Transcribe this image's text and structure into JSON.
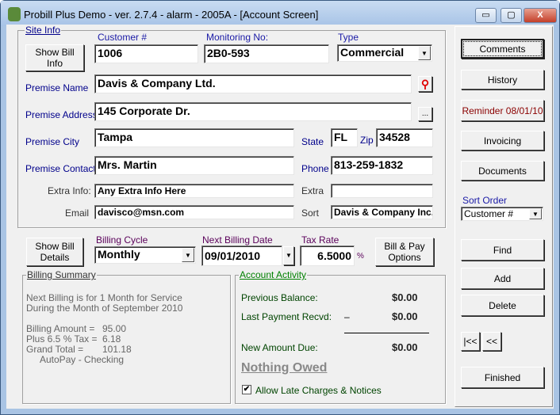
{
  "window": {
    "title": "Probill Plus Demo - ver. 2.7.4 - alarm - 2005A - [Account Screen]",
    "minimize": "▭",
    "maximize": "▢",
    "close": "X"
  },
  "site_info": {
    "group_label": "Site Info",
    "show_bill_info": "Show Bill Info",
    "customer_label": "Customer #",
    "customer": "1006",
    "monitoring_label": "Monitoring No:",
    "monitoring": "2B0-593",
    "type_label": "Type",
    "type": "Commercial",
    "premise_name_label": "Premise Name",
    "premise_name": "Davis & Company Ltd.",
    "premise_address_label": "Premise Address",
    "premise_address": "145 Corporate Dr.",
    "ellipsis": "...",
    "premise_city_label": "Premise City",
    "premise_city": "Tampa",
    "state_label": "State",
    "state": "FL",
    "zip_label": "Zip",
    "zip": "34528",
    "premise_contact_label": "Premise Contact",
    "premise_contact": "Mrs. Martin",
    "phone_label": "Phone",
    "phone": "813-259-1832",
    "extra_info_label": "Extra Info:",
    "extra_info": "Any Extra Info Here",
    "extra_label": "Extra",
    "extra": "",
    "email_label": "Email",
    "email": "davisco@msn.com",
    "sort_label": "Sort",
    "sort": "Davis & Company Inc."
  },
  "billing": {
    "show_bill_details": "Show Bill Details",
    "cycle_label": "Billing Cycle",
    "cycle": "Monthly",
    "next_date_label": "Next Billing Date",
    "next_date": "09/01/2010",
    "tax_label": "Tax Rate",
    "tax": "6.5000",
    "tax_unit": "%",
    "bill_pay_options": "Bill & Pay Options"
  },
  "summary": {
    "group_label": "Billing Summary",
    "line1": "Next Billing is for 1 Month for Service",
    "line2": "During the Month of September 2010",
    "amount_label": "Billing Amount =",
    "amount": "95.00",
    "tax_label": "Plus 6.5 % Tax =",
    "tax": "6.18",
    "total_label": "Grand Total =",
    "total": "101.18",
    "autopay": "AutoPay - Checking"
  },
  "activity": {
    "group_label": "Account Activity",
    "prev_label": "Previous Balance:",
    "prev": "$0.00",
    "last_label": "Last Payment Recvd:",
    "last_dash": "–",
    "last": "$0.00",
    "due_label": "New Amount Due:",
    "due": "$0.00",
    "status": "Nothing Owed",
    "late_label": "Allow Late Charges & Notices",
    "late_checked": true
  },
  "side": {
    "comments": "Comments",
    "history": "History",
    "reminder": "Reminder 08/01/10",
    "invoicing": "Invoicing",
    "documents": "Documents",
    "sort_order_label": "Sort Order",
    "sort_order": "Customer #",
    "find": "Find",
    "add": "Add",
    "delete": "Delete",
    "first": "|<<",
    "prev": "<<",
    "finished": "Finished"
  },
  "colors": {
    "reminder": "#8b0000",
    "pin": "#e00000",
    "activity": "#008000"
  }
}
